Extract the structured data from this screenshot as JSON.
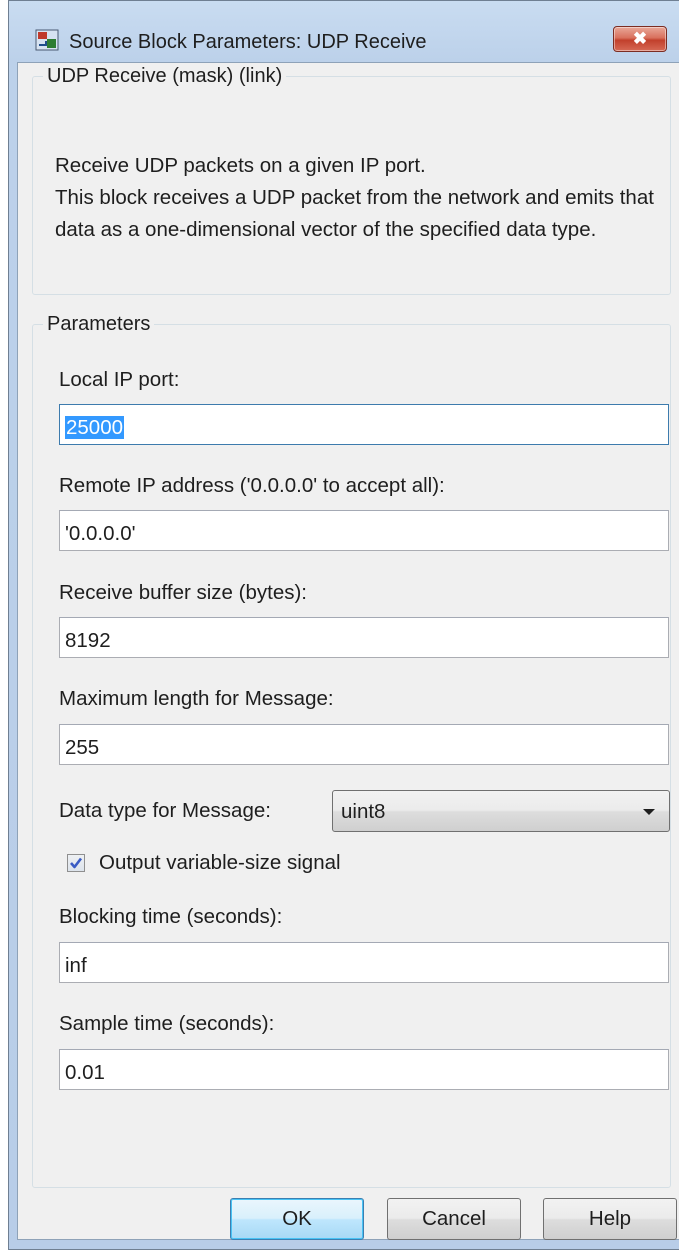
{
  "window": {
    "title": "Source Block Parameters: UDP Receive",
    "close_glyph": "✖",
    "close_icon": "close-icon",
    "app_icon": "simulink-block-icon"
  },
  "description_group": {
    "legend": "UDP Receive (mask) (link)",
    "line1": "Receive UDP packets on a given IP port.",
    "line2": "This block receives a UDP packet from the network and emits that data as a one-dimensional vector of the specified data type."
  },
  "parameters_group": {
    "legend": "Parameters",
    "local_ip_port": {
      "label": "Local IP port:",
      "value": "25000"
    },
    "remote_ip_address": {
      "label": "Remote IP address ('0.0.0.0' to accept all):",
      "value": "'0.0.0.0'"
    },
    "receive_buffer_size": {
      "label": "Receive buffer size (bytes):",
      "value": "8192"
    },
    "max_message_length": {
      "label": "Maximum length for Message:",
      "value": "255"
    },
    "data_type": {
      "label": "Data type for Message:",
      "value": "uint8"
    },
    "output_variable_size": {
      "label": "Output variable-size signal",
      "checked": true
    },
    "blocking_time": {
      "label": "Blocking time (seconds):",
      "value": "inf"
    },
    "sample_time": {
      "label": "Sample time (seconds):",
      "value": "0.01"
    }
  },
  "buttons": {
    "ok": "OK",
    "cancel": "Cancel",
    "help": "Help"
  },
  "colors": {
    "accent": "#3399ff",
    "close_button": "#c2402c",
    "default_button": "#3c7fb1"
  }
}
